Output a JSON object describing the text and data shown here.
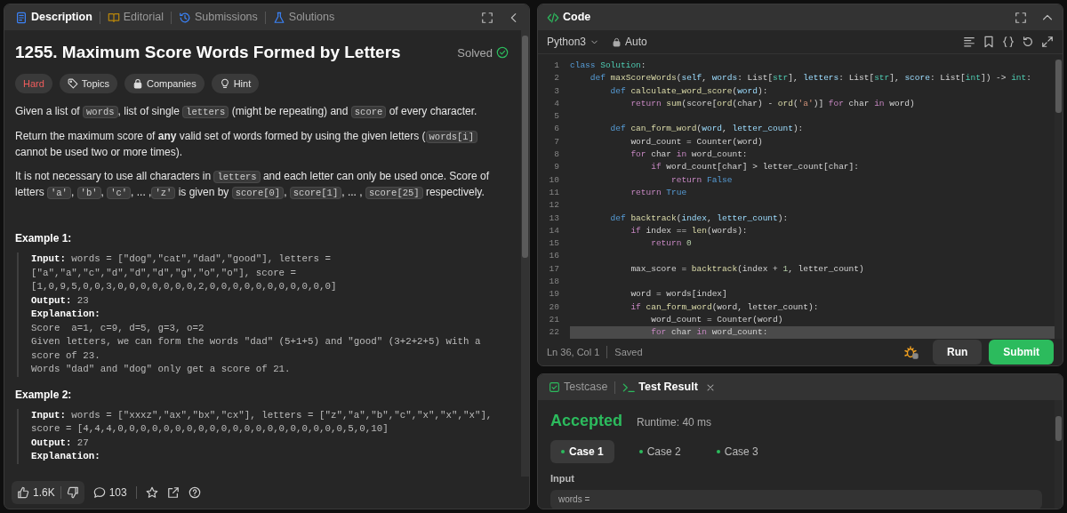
{
  "problem_panel": {
    "tabs": [
      {
        "label": "Description",
        "selected": true
      },
      {
        "label": "Editorial",
        "selected": false
      },
      {
        "label": "Submissions",
        "selected": false
      },
      {
        "label": "Solutions",
        "selected": false
      }
    ],
    "title": "1255. Maximum Score Words Formed by Letters",
    "status": "Solved",
    "tags": [
      {
        "label": "Hard",
        "kind": "difficulty"
      },
      {
        "label": "Topics",
        "kind": "topics"
      },
      {
        "label": "Companies",
        "kind": "companies"
      },
      {
        "label": "Hint",
        "kind": "hint"
      }
    ],
    "paragraphs": [
      [
        {
          "kind": "text",
          "text": "Given a list of "
        },
        {
          "kind": "code",
          "text": "words"
        },
        {
          "kind": "text",
          "text": ", list of single "
        },
        {
          "kind": "code",
          "text": "letters"
        },
        {
          "kind": "text",
          "text": " (might be repeating) and "
        },
        {
          "kind": "code",
          "text": "score"
        },
        {
          "kind": "text",
          "text": " of every character."
        }
      ],
      [
        {
          "kind": "text",
          "text": "Return the maximum score of "
        },
        {
          "kind": "bold",
          "text": "any"
        },
        {
          "kind": "text",
          "text": " valid set of words formed by using the given letters ("
        },
        {
          "kind": "code",
          "text": "words[i]"
        },
        {
          "kind": "text",
          "text": " cannot be used two or more times)."
        }
      ],
      [
        {
          "kind": "text",
          "text": "It is not necessary to use all characters in "
        },
        {
          "kind": "code",
          "text": "letters"
        },
        {
          "kind": "text",
          "text": " and each letter can only be used once. Score of letters "
        },
        {
          "kind": "code",
          "text": "'a'"
        },
        {
          "kind": "text",
          "text": ", "
        },
        {
          "kind": "code",
          "text": "'b'"
        },
        {
          "kind": "text",
          "text": ", "
        },
        {
          "kind": "code",
          "text": "'c'"
        },
        {
          "kind": "text",
          "text": ", ... ,"
        },
        {
          "kind": "code",
          "text": "'z'"
        },
        {
          "kind": "text",
          "text": " is given by "
        },
        {
          "kind": "code",
          "text": "score[0]"
        },
        {
          "kind": "text",
          "text": ", "
        },
        {
          "kind": "code",
          "text": "score[1]"
        },
        {
          "kind": "text",
          "text": ", ... , "
        },
        {
          "kind": "code",
          "text": "score[25]"
        },
        {
          "kind": "text",
          "text": " respectively."
        }
      ]
    ],
    "examples": [
      {
        "heading": "Example 1:",
        "lines": [
          {
            "label": "Input:",
            "text": "words = [\"dog\",\"cat\",\"dad\",\"good\"], letters = [\"a\",\"a\",\"c\",\"d\",\"d\",\"d\",\"g\",\"o\",\"o\"], score = [1,0,9,5,0,0,3,0,0,0,0,0,0,0,2,0,0,0,0,0,0,0,0,0,0,0]"
          },
          {
            "label": "Output:",
            "text": "23"
          },
          {
            "label": "Explanation:",
            "text": "Score  a=1, c=9, d=5, g=3, o=2\nGiven letters, we can form the words \"dad\" (5+1+5) and \"good\" (3+2+2+5) with a score of 23.\nWords \"dad\" and \"dog\" only get a score of 21."
          }
        ]
      },
      {
        "heading": "Example 2:",
        "lines": [
          {
            "label": "Input:",
            "text": "words = [\"xxxz\",\"ax\",\"bx\",\"cx\"], letters = [\"z\",\"a\",\"b\",\"c\",\"x\",\"x\",\"x\"], score = [4,4,4,0,0,0,0,0,0,0,0,0,0,0,0,0,0,0,0,0,0,0,0,5,0,10]"
          },
          {
            "label": "Output:",
            "text": "27"
          },
          {
            "label": "Explanation:"
          }
        ]
      }
    ],
    "footer": {
      "likes": "1.6K",
      "comments": "103"
    }
  },
  "code_panel": {
    "title": "Code",
    "language": "Python3",
    "mode": "Auto",
    "lines": [
      {
        "number": "1",
        "current": false,
        "tokens": [
          {
            "kind": "d",
            "text": "class"
          },
          {
            "kind": "c",
            "text": " Solution"
          },
          {
            "kind": "p",
            "text": ":"
          }
        ]
      },
      {
        "number": "2",
        "current": false,
        "tokens": [
          {
            "kind": "d",
            "text": "    def"
          },
          {
            "kind": "f",
            "text": " maxScoreWords"
          },
          {
            "kind": "p",
            "text": "("
          },
          {
            "kind": "v",
            "text": "self"
          },
          {
            "kind": "p",
            "text": ", "
          },
          {
            "kind": "v",
            "text": "words"
          },
          {
            "kind": "p",
            "text": ": List["
          },
          {
            "kind": "c",
            "text": "str"
          },
          {
            "kind": "p",
            "text": "], "
          },
          {
            "kind": "v",
            "text": "letters"
          },
          {
            "kind": "p",
            "text": ": List["
          },
          {
            "kind": "c",
            "text": "str"
          },
          {
            "kind": "p",
            "text": "], "
          },
          {
            "kind": "v",
            "text": "score"
          },
          {
            "kind": "p",
            "text": ": List["
          },
          {
            "kind": "c",
            "text": "int"
          },
          {
            "kind": "p",
            "text": "]) -> "
          },
          {
            "kind": "c",
            "text": "int"
          },
          {
            "kind": "p",
            "text": ":"
          }
        ]
      },
      {
        "number": "3",
        "current": false,
        "tokens": [
          {
            "kind": "d",
            "text": "        def"
          },
          {
            "kind": "f",
            "text": " calculate_word_score"
          },
          {
            "kind": "p",
            "text": "("
          },
          {
            "kind": "v",
            "text": "word"
          },
          {
            "kind": "p",
            "text": "):"
          }
        ]
      },
      {
        "number": "4",
        "current": false,
        "tokens": [
          {
            "kind": "k",
            "text": "            return"
          },
          {
            "kind": "f",
            "text": " sum"
          },
          {
            "kind": "p",
            "text": "(score["
          },
          {
            "kind": "f",
            "text": "ord"
          },
          {
            "kind": "p",
            "text": "(char) - "
          },
          {
            "kind": "f",
            "text": "ord"
          },
          {
            "kind": "p",
            "text": "("
          },
          {
            "kind": "s",
            "text": "'a'"
          },
          {
            "kind": "p",
            "text": ")] "
          },
          {
            "kind": "k",
            "text": "for"
          },
          {
            "kind": "p",
            "text": " char "
          },
          {
            "kind": "k",
            "text": "in"
          },
          {
            "kind": "p",
            "text": " word)"
          }
        ]
      },
      {
        "number": "5",
        "current": false
      },
      {
        "number": "6",
        "current": false,
        "tokens": [
          {
            "kind": "d",
            "text": "        def"
          },
          {
            "kind": "f",
            "text": " can_form_word"
          },
          {
            "kind": "p",
            "text": "("
          },
          {
            "kind": "v",
            "text": "word"
          },
          {
            "kind": "p",
            "text": ", "
          },
          {
            "kind": "v",
            "text": "letter_count"
          },
          {
            "kind": "p",
            "text": "):"
          }
        ]
      },
      {
        "number": "7",
        "current": false,
        "tokens": [
          {
            "kind": "p",
            "text": "            word_count = Counter(word)"
          }
        ]
      },
      {
        "number": "8",
        "current": false,
        "tokens": [
          {
            "kind": "k",
            "text": "            for"
          },
          {
            "kind": "p",
            "text": " char "
          },
          {
            "kind": "k",
            "text": "in"
          },
          {
            "kind": "p",
            "text": " word_count:"
          }
        ]
      },
      {
        "number": "9",
        "current": false,
        "tokens": [
          {
            "kind": "k",
            "text": "                if"
          },
          {
            "kind": "p",
            "text": " word_count[char] > letter_count[char]:"
          }
        ]
      },
      {
        "number": "10",
        "current": false,
        "tokens": [
          {
            "kind": "k",
            "text": "                    return"
          },
          {
            "kind": "d",
            "text": " False"
          }
        ]
      },
      {
        "number": "11",
        "current": false,
        "tokens": [
          {
            "kind": "k",
            "text": "            return"
          },
          {
            "kind": "d",
            "text": " True"
          }
        ]
      },
      {
        "number": "12",
        "current": false
      },
      {
        "number": "13",
        "current": false,
        "tokens": [
          {
            "kind": "d",
            "text": "        def"
          },
          {
            "kind": "f",
            "text": " backtrack"
          },
          {
            "kind": "p",
            "text": "("
          },
          {
            "kind": "v",
            "text": "index"
          },
          {
            "kind": "p",
            "text": ", "
          },
          {
            "kind": "v",
            "text": "letter_count"
          },
          {
            "kind": "p",
            "text": "):"
          }
        ]
      },
      {
        "number": "14",
        "current": false,
        "tokens": [
          {
            "kind": "k",
            "text": "            if"
          },
          {
            "kind": "p",
            "text": " index == "
          },
          {
            "kind": "f",
            "text": "len"
          },
          {
            "kind": "p",
            "text": "(words):"
          }
        ]
      },
      {
        "number": "15",
        "current": false,
        "tokens": [
          {
            "kind": "k",
            "text": "                return"
          },
          {
            "kind": "n",
            "text": " 0"
          }
        ]
      },
      {
        "number": "16",
        "current": false
      },
      {
        "number": "17",
        "current": false,
        "tokens": [
          {
            "kind": "p",
            "text": "            max_score = "
          },
          {
            "kind": "f",
            "text": "backtrack"
          },
          {
            "kind": "p",
            "text": "(index + "
          },
          {
            "kind": "n",
            "text": "1"
          },
          {
            "kind": "p",
            "text": ", letter_count)"
          }
        ]
      },
      {
        "number": "18",
        "current": false
      },
      {
        "number": "19",
        "current": false,
        "tokens": [
          {
            "kind": "p",
            "text": "            word = words[index]"
          }
        ]
      },
      {
        "number": "20",
        "current": false,
        "tokens": [
          {
            "kind": "k",
            "text": "            if"
          },
          {
            "kind": "f",
            "text": " can_form_word"
          },
          {
            "kind": "p",
            "text": "(word, letter_count):"
          }
        ]
      },
      {
        "number": "21",
        "current": false,
        "tokens": [
          {
            "kind": "p",
            "text": "                word_count = Counter(word)"
          }
        ]
      },
      {
        "number": "22",
        "current": true,
        "tokens": [
          {
            "kind": "k",
            "text": "                for"
          },
          {
            "kind": "p",
            "text": " char "
          },
          {
            "kind": "k",
            "text": "in"
          },
          {
            "kind": "p",
            "text": " word_count:"
          }
        ]
      }
    ],
    "cursor": "Ln 36, Col 1",
    "save_state": "Saved",
    "buttons": [
      {
        "label": "Run",
        "kind": "secondary"
      },
      {
        "label": "Submit",
        "kind": "primary"
      }
    ]
  },
  "result_panel": {
    "tabs": [
      {
        "label": "Testcase",
        "selected": false
      },
      {
        "label": "Test Result",
        "selected": true
      }
    ],
    "verdict": "Accepted",
    "runtime": "Runtime: 40 ms",
    "cases": [
      {
        "label": "Case 1",
        "selected": true
      },
      {
        "label": "Case 2",
        "selected": false
      },
      {
        "label": "Case 3",
        "selected": false
      }
    ],
    "input_label": "Input",
    "input_value": "words ="
  }
}
